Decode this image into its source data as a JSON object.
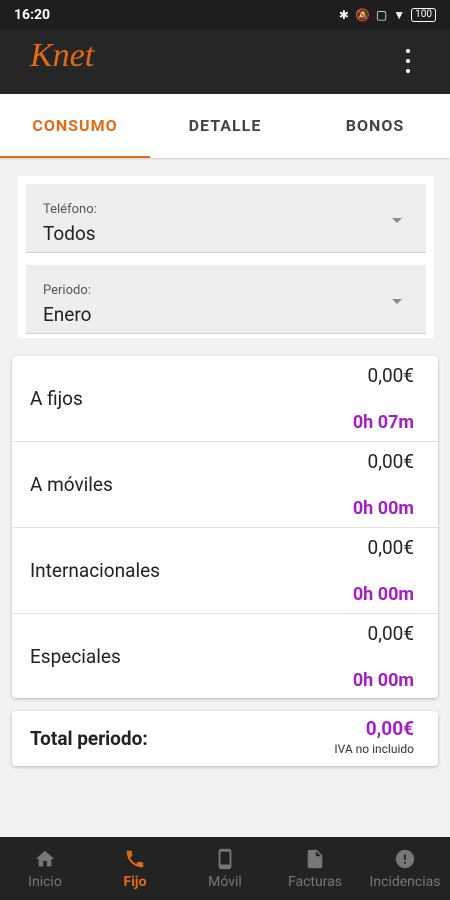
{
  "statusbar": {
    "time": "16:20",
    "battery": "100"
  },
  "appbar": {
    "logo": "Knet"
  },
  "tabs": [
    {
      "label": "CONSUMO",
      "active": true
    },
    {
      "label": "DETALLE",
      "active": false
    },
    {
      "label": "BONOS",
      "active": false
    }
  ],
  "filters": {
    "phone": {
      "label": "Teléfono:",
      "value": "Todos"
    },
    "period": {
      "label": "Periodo:",
      "value": "Enero"
    }
  },
  "usage": [
    {
      "name": "A fijos",
      "amount": "0,00€",
      "time": "0h 07m"
    },
    {
      "name": "A móviles",
      "amount": "0,00€",
      "time": "0h 00m"
    },
    {
      "name": "Internacionales",
      "amount": "0,00€",
      "time": "0h 00m"
    },
    {
      "name": "Especiales",
      "amount": "0,00€",
      "time": "0h 00m"
    }
  ],
  "total": {
    "label": "Total periodo:",
    "amount": "0,00€",
    "note": "IVA no incluido"
  },
  "bottom_nav": [
    {
      "label": "Inicio",
      "icon": "home-icon",
      "active": false
    },
    {
      "label": "Fijo",
      "icon": "phone-icon",
      "active": true
    },
    {
      "label": "Móvil",
      "icon": "mobile-icon",
      "active": false
    },
    {
      "label": "Facturas",
      "icon": "document-icon",
      "active": false
    },
    {
      "label": "Incidencias",
      "icon": "alert-icon",
      "active": false
    }
  ],
  "colors": {
    "accent": "#e36a14",
    "highlight": "#a31fc4",
    "bar": "#262626"
  }
}
